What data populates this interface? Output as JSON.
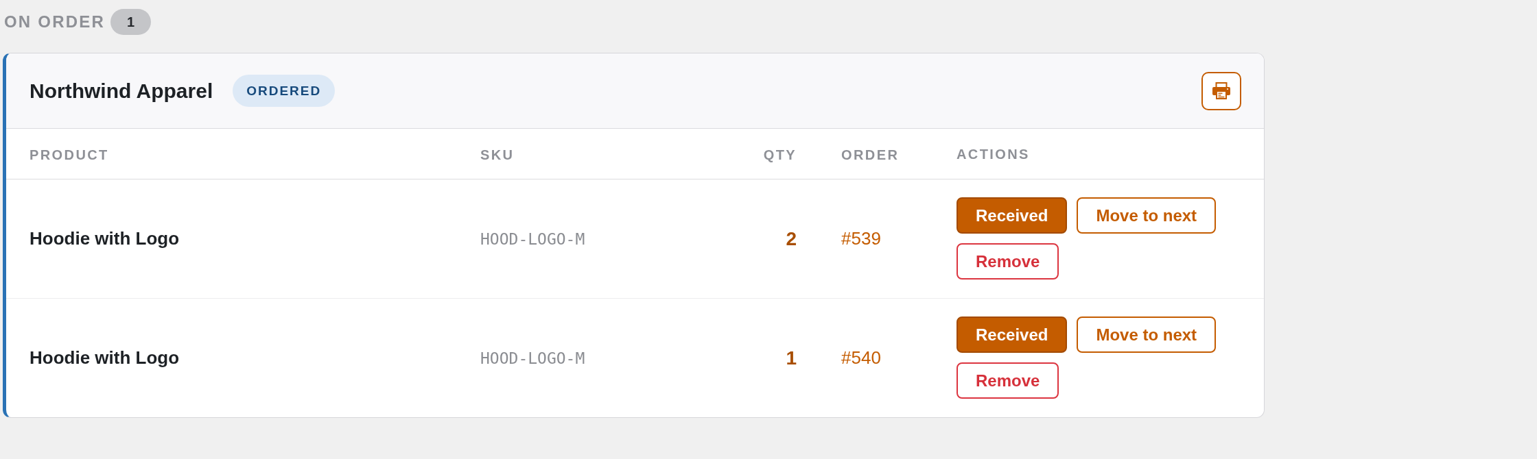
{
  "section": {
    "title": "ON ORDER",
    "count": "1"
  },
  "card": {
    "supplier": "Northwind Apparel",
    "status": "ORDERED",
    "table": {
      "columns": [
        "PRODUCT",
        "SKU",
        "QTY",
        "ORDER",
        "ACTIONS"
      ],
      "rows": [
        {
          "product": "Hoodie with Logo",
          "sku": "HOOD-LOGO-M",
          "qty": "2",
          "order": "#539",
          "actions": [
            {
              "label": "Received",
              "kind": "primary"
            },
            {
              "label": "Move to next",
              "kind": "outline"
            },
            {
              "label": "Remove",
              "kind": "danger"
            }
          ]
        },
        {
          "product": "Hoodie with Logo",
          "sku": "HOOD-LOGO-M",
          "qty": "1",
          "order": "#540",
          "actions": [
            {
              "label": "Received",
              "kind": "primary"
            },
            {
              "label": "Move to next",
              "kind": "outline"
            },
            {
              "label": "Remove",
              "kind": "danger"
            }
          ]
        }
      ]
    }
  }
}
